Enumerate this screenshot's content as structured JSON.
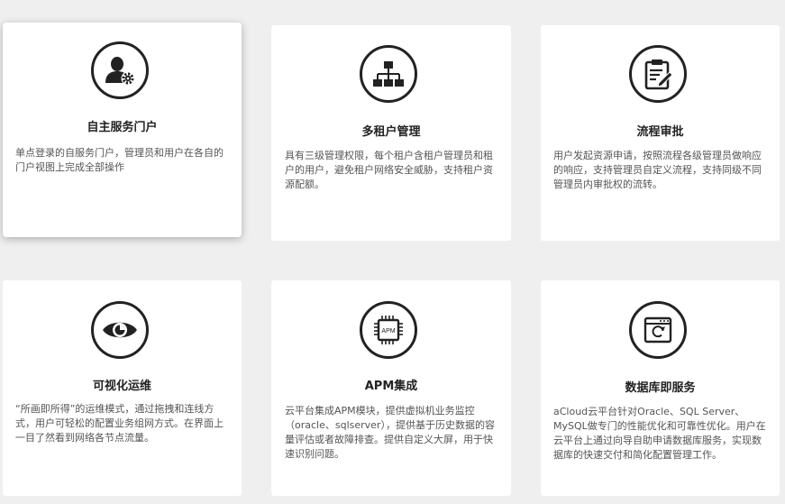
{
  "cards": [
    {
      "title": "自主服务门户",
      "description": "单点登录的自服务门户，管理员和用户在各自的门户视图上完成全部操作",
      "icon": "user-gear-icon"
    },
    {
      "title": "多租户管理",
      "description": "具有三级管理权限，每个租户含租户管理员和租户的用户，避免租户网络安全威胁，支持租户资源配额。",
      "icon": "org-hierarchy-icon"
    },
    {
      "title": "流程审批",
      "description": "用户发起资源申请，按照流程各级管理员做响应的响应，支持管理员自定义流程，支持同级不同管理员内审批权的流转。",
      "icon": "clipboard-edit-icon"
    },
    {
      "title": "可视化运维",
      "description": "“所画即所得”的运维模式，通过拖拽和连线方式，用户可轻松的配置业务组网方式。在界面上一目了然看到网络各节点流量。",
      "icon": "eye-icon"
    },
    {
      "title": "APM集成",
      "description": "云平台集成APM模块，提供虚拟机业务监控（oracle、sqlserver），提供基于历史数据的容量评估或者故障排查。提供自定义大屏，用于快速识别问题。",
      "icon": "apm-chip-icon",
      "icon_text": "APM"
    },
    {
      "title": "数据库即服务",
      "description": "aCloud云平台针对Oracle、SQL Server、MySQL做专门的性能优化和可靠性优化。用户在云平台上通过向导自助申请数据库服务，实现数据库的快速交付和简化配置管理工作。",
      "icon": "database-window-refresh-icon"
    }
  ]
}
